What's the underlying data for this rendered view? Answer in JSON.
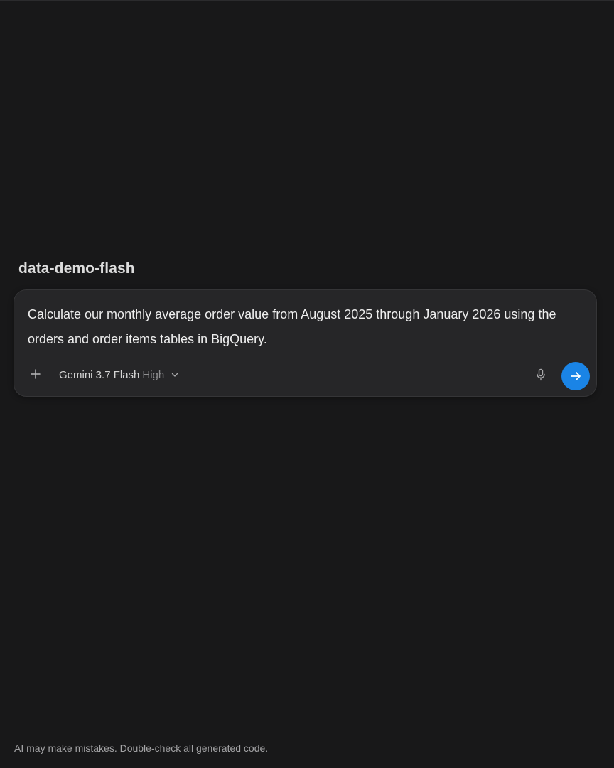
{
  "project": {
    "title": "data-demo-flash"
  },
  "composer": {
    "prompt": "Calculate our monthly average order value from August 2025 through January 2026 using the orders and order items tables in BigQuery.",
    "model_name": "Gemini 3.7 Flash",
    "model_mode": "High",
    "icons": {
      "add": "plus-icon",
      "model_dropdown": "chevron-down-icon",
      "voice": "microphone-icon",
      "send": "arrow-right-icon"
    }
  },
  "footer": {
    "disclaimer": "AI may make mistakes. Double-check all generated code."
  },
  "colors": {
    "background": "#181819",
    "composer_background": "#262628",
    "send_button": "#1a84e6",
    "muted_text": "#8e8e90"
  }
}
